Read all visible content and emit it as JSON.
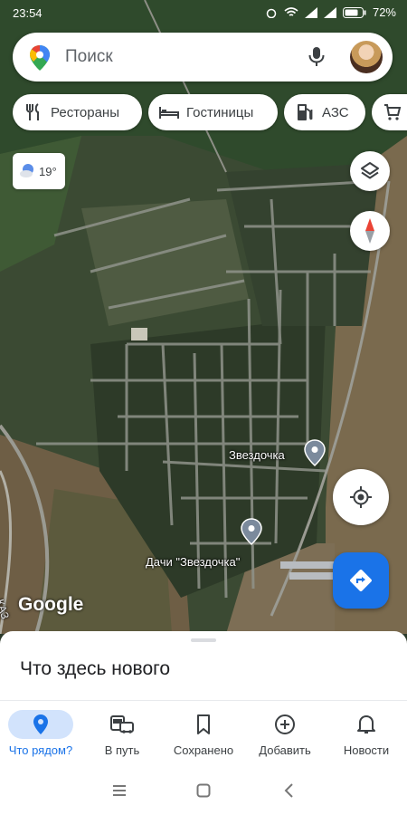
{
  "status_bar": {
    "time": "23:54",
    "battery": "72%"
  },
  "search": {
    "placeholder": "Поиск"
  },
  "chips": [
    {
      "label": "Рестораны",
      "icon": "fork-knife-icon"
    },
    {
      "label": "Гостиницы",
      "icon": "bed-icon"
    },
    {
      "label": "АЗС",
      "icon": "gas-station-icon"
    },
    {
      "label": "",
      "icon": "cart-icon"
    }
  ],
  "weather": {
    "temp": "19°"
  },
  "map": {
    "places": [
      {
        "name": "Звездочка"
      },
      {
        "name": "Дачи \"Звездочка\""
      }
    ],
    "road_label": "КАЗ",
    "attribution": "Google"
  },
  "sheet": {
    "title": "Что здесь нового"
  },
  "bottom_nav": [
    {
      "label": "Что рядом?",
      "icon": "location-pin-icon",
      "active": true
    },
    {
      "label": "В путь",
      "icon": "commute-icon",
      "active": false
    },
    {
      "label": "Сохранено",
      "icon": "bookmark-icon",
      "active": false
    },
    {
      "label": "Добавить",
      "icon": "add-circle-icon",
      "active": false
    },
    {
      "label": "Новости",
      "icon": "bell-icon",
      "active": false
    }
  ],
  "colors": {
    "accent": "#1a73e8",
    "active_bg": "#d2e3fc",
    "directions_fab": "#1a73e8"
  }
}
